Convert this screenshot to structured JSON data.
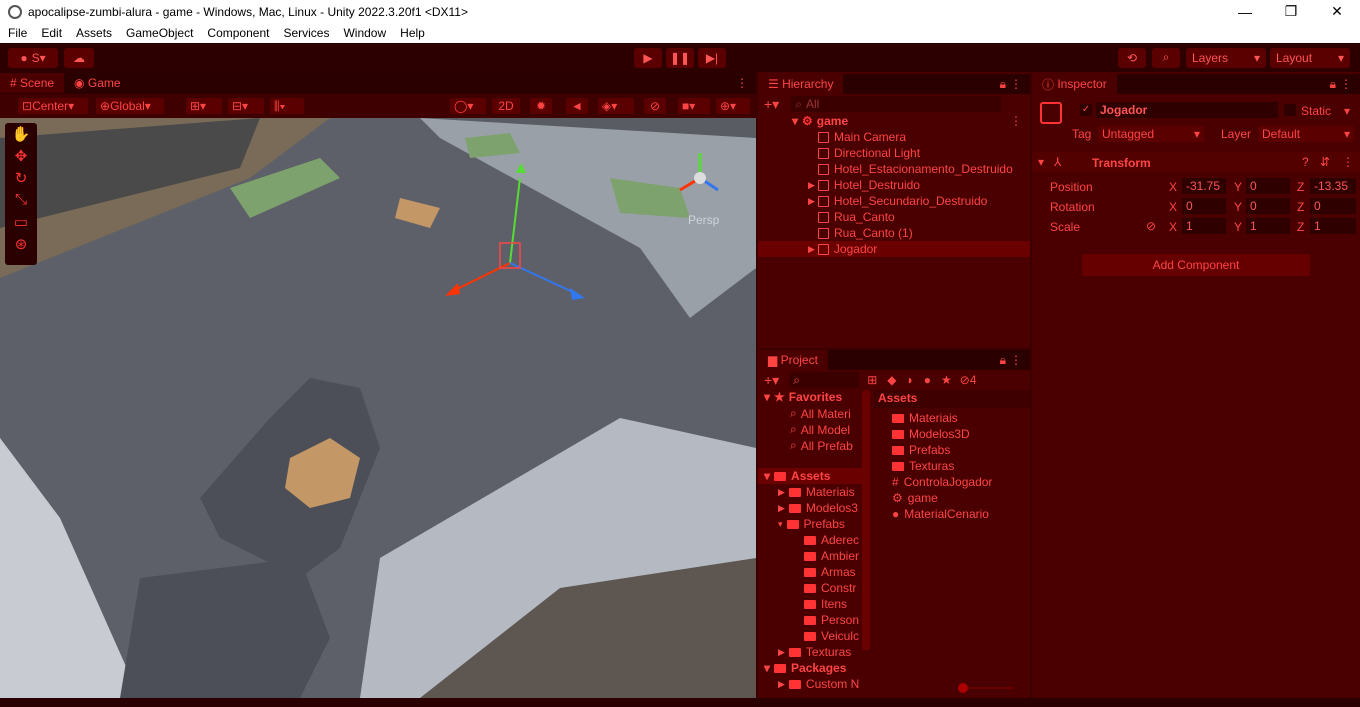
{
  "window": {
    "title": "apocalipse-zumbi-alura - game - Windows, Mac, Linux - Unity 2022.3.20f1 <DX11>",
    "min": "—",
    "max": "❐",
    "close": "✕"
  },
  "menu": [
    "File",
    "Edit",
    "Assets",
    "GameObject",
    "Component",
    "Services",
    "Window",
    "Help"
  ],
  "toolbar": {
    "account": "S",
    "layers": "Layers",
    "layout": "Layout"
  },
  "scene_tabs": {
    "scene": "Scene",
    "game": "Game"
  },
  "scene_toolbar": {
    "center": "Center",
    "global": "Global",
    "two_d": "2D",
    "persp": "Persp"
  },
  "hierarchy": {
    "title": "Hierarchy",
    "search": "All",
    "root": "game",
    "items": [
      "Main Camera",
      "Directional Light",
      "Hotel_Estacionamento_Destruido",
      "Hotel_Destruido",
      "Hotel_Secundario_Destruido",
      "Rua_Canto",
      "Rua_Canto (1)",
      "Jogador"
    ]
  },
  "inspector": {
    "title": "Inspector",
    "object_name": "Jogador",
    "static_label": "Static",
    "tag_label": "Tag",
    "tag_value": "Untagged",
    "layer_label": "Layer",
    "layer_value": "Default",
    "transform": "Transform",
    "position": "Position",
    "rotation": "Rotation",
    "scale": "Scale",
    "px": "-31.75",
    "py": "0",
    "pz": "-13.35",
    "rx": "0",
    "ry": "0",
    "rz": "0",
    "sx": "1",
    "sy": "1",
    "sz": "1",
    "axis_x": "X",
    "axis_y": "Y",
    "axis_z": "Z",
    "add_component": "Add Component"
  },
  "project": {
    "title": "Project",
    "hidden_count": "4",
    "favorites": "Favorites",
    "fav_items": [
      "All Materi",
      "All Model",
      "All Prefab"
    ],
    "assets": "Assets",
    "tree": [
      "Materiais",
      "Modelos3",
      "Prefabs",
      "Aderec",
      "Ambier",
      "Armas",
      "Constr",
      "Itens",
      "Person",
      "Veiculc",
      "Texturas"
    ],
    "packages": "Packages",
    "pkg_items": [
      "Custom N"
    ],
    "assets_header": "Assets",
    "asset_items": [
      "Materiais",
      "Modelos3D",
      "Prefabs",
      "Texturas",
      "ControlaJogador",
      "game",
      "MaterialCenario"
    ]
  }
}
